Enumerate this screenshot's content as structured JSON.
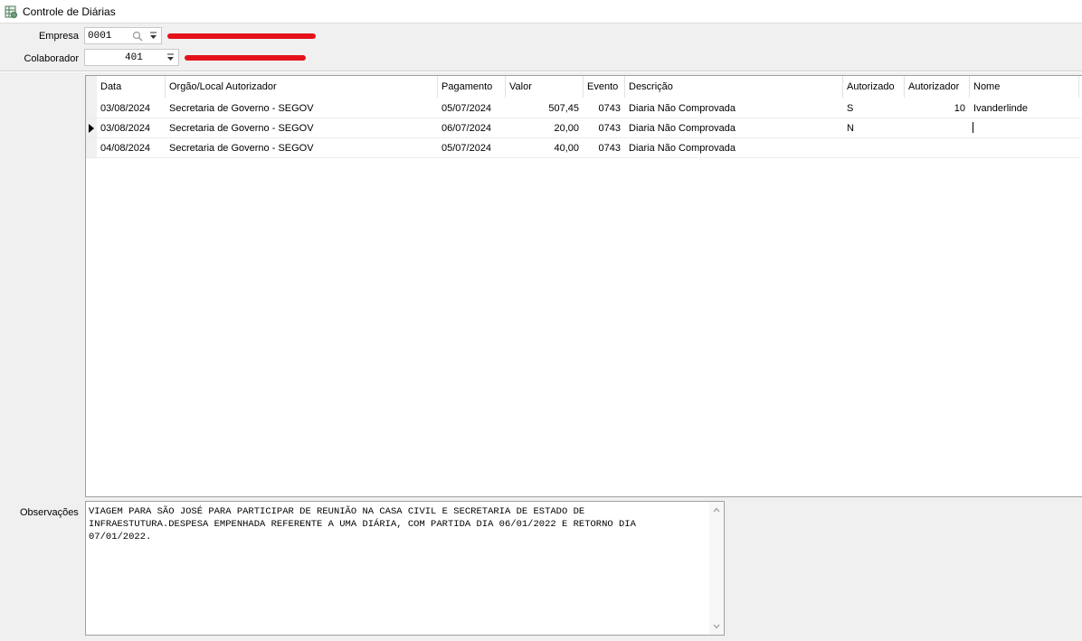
{
  "window": {
    "title": "Controle de Diárias"
  },
  "filters": {
    "empresa_label": "Empresa",
    "empresa_value": "0001",
    "colaborador_label": "Colaborador",
    "colaborador_value": "401"
  },
  "grid": {
    "columns": [
      "Data",
      "Orgão/Local Autorizador",
      "Pagamento",
      "Valor",
      "Evento",
      "Descrição",
      "Autorizado",
      "Autorizador",
      "Nome"
    ],
    "rows": [
      {
        "data": "03/08/2024",
        "orgao": "Secretaria de Governo - SEGOV",
        "pagamento": "05/07/2024",
        "valor": "507,45",
        "evento": "0743",
        "descricao": "Diaria Não Comprovada",
        "autorizado": "S",
        "autorizador": "10",
        "nome": "Ivanderlinde"
      },
      {
        "data": "03/08/2024",
        "orgao": "Secretaria de Governo - SEGOV",
        "pagamento": "06/07/2024",
        "valor": "20,00",
        "evento": "0743",
        "descricao": "Diaria Não Comprovada",
        "autorizado": "N",
        "autorizador": "",
        "nome": ""
      },
      {
        "data": "04/08/2024",
        "orgao": "Secretaria de Governo - SEGOV",
        "pagamento": "05/07/2024",
        "valor": "40,00",
        "evento": "0743",
        "descricao": "Diaria Não Comprovada",
        "autorizado": "",
        "autorizador": "",
        "nome": ""
      }
    ]
  },
  "observacoes": {
    "label": "Observações",
    "text": "VIAGEM PARA SÃO JOSÉ PARA PARTICIPAR DE REUNIÃO NA CASA CIVIL E SECRETARIA DE ESTADO DE\nINFRAESTUTURA.DESPESA EMPENHADA REFERENTE A UMA DIÁRIA, COM PARTIDA DIA 06/01/2022 E RETORNO DIA\n07/01/2022."
  },
  "colors": {
    "redaction": "#e5121b",
    "border": "#a0a0a0",
    "background": "#f0f0f0"
  },
  "icons": {
    "app": "table-icon",
    "lookup": "search-icon",
    "dropdown": "dropdown-arrow-icon"
  }
}
